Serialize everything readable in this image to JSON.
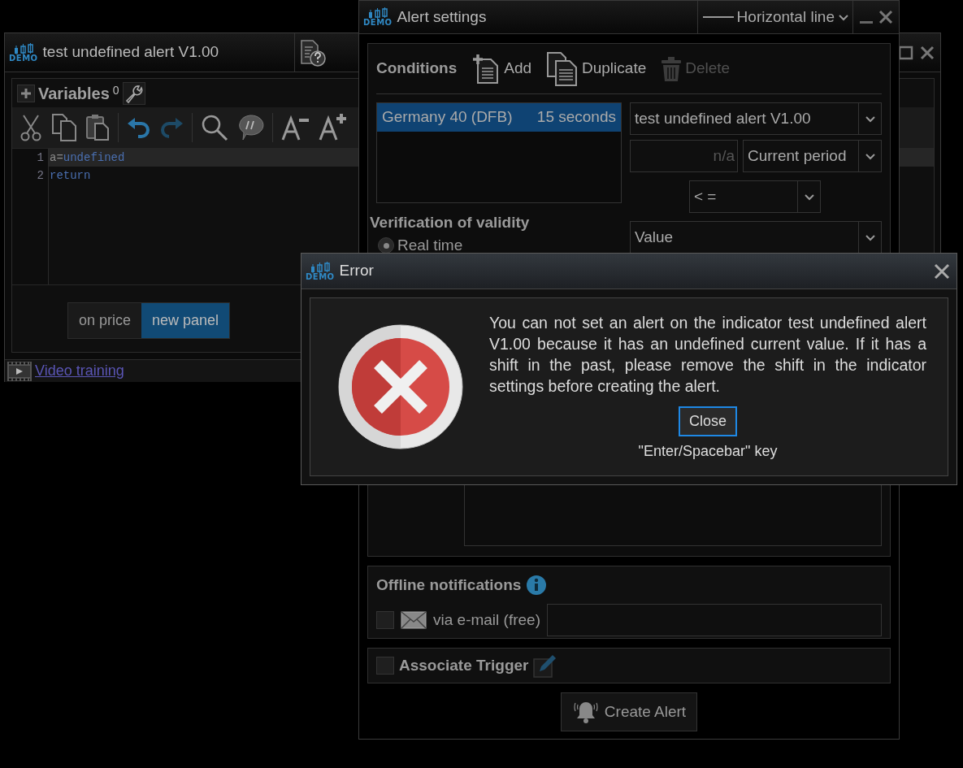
{
  "editor_window": {
    "logo": "DEMO",
    "title": "test undefined alert V1.00",
    "variables": {
      "label": "Variables",
      "count": "0"
    },
    "code_lines": [
      {
        "number": "1",
        "current": true,
        "tokens": [
          {
            "text": "a=",
            "kind": "plain"
          },
          {
            "text": "undefined",
            "kind": "keyword"
          }
        ]
      },
      {
        "number": "2",
        "current": false,
        "tokens": [
          {
            "text": "return",
            "kind": "keyword"
          }
        ]
      }
    ],
    "placement": [
      {
        "label": "on price",
        "selected": false
      },
      {
        "label": "new panel",
        "selected": true
      }
    ],
    "video_link": "Video training"
  },
  "alert_window": {
    "logo": "DEMO",
    "title": "Alert settings",
    "line_style": "Horizontal line",
    "conditions": {
      "label": "Conditions",
      "actions": [
        {
          "kind": "add",
          "label": "Add",
          "disabled": false
        },
        {
          "kind": "duplicate",
          "label": "Duplicate",
          "disabled": false
        },
        {
          "kind": "delete",
          "label": "Delete",
          "disabled": true
        }
      ]
    },
    "condition_list": [
      {
        "instrument": "Germany 40 (DFB)",
        "period": "15 seconds",
        "selected": true
      }
    ],
    "indicator_select": "test undefined alert V1.00",
    "value_field": {
      "placeholder": "n/a"
    },
    "period_select": "Current period",
    "operator_select": "< =",
    "compare_select": "Value",
    "verification": {
      "label": "Verification of validity",
      "options": [
        {
          "label": "Real time",
          "selected": true
        }
      ]
    },
    "offline": {
      "label": "Offline notifications",
      "email": {
        "label": "via e-mail (free)",
        "checked": false
      }
    },
    "trigger": {
      "label": "Associate Trigger",
      "checked": false
    },
    "create_button": "Create Alert"
  },
  "error_dialog": {
    "logo": "DEMO",
    "title": "Error",
    "message": "You can not set an alert on the indicator test undefined alert V1.00 because it has an undefined current value. If it has a shift in the past, please remove the shift in the indicator settings before creating the alert.",
    "button": "Close",
    "hint": "\"Enter/Spacebar\" key"
  }
}
